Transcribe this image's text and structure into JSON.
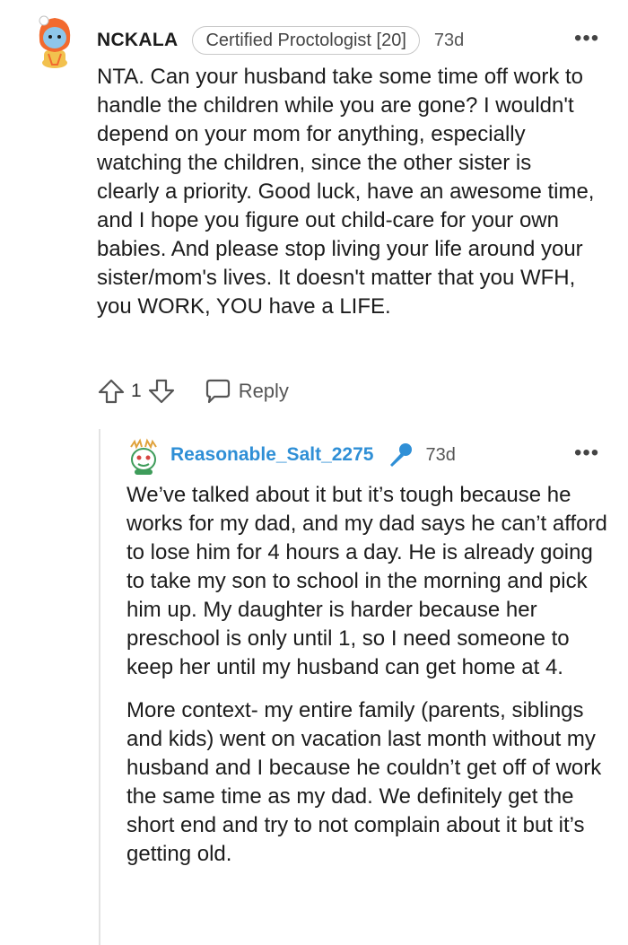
{
  "comment": {
    "author": "NCKALA",
    "flair": "Certified Proctologist [20]",
    "age": "73d",
    "body": "NTA. Can your husband take some time off work to handle the children while you are gone? I wouldn't depend on your mom for anything, especially watching the children, since the other sister is clearly a priority. Good luck, have an awesome time, and I hope you figure out child-care for your own babies. And please stop living your life around your sister/mom's lives. It doesn't matter that you WFH, you WORK, YOU have a LIFE.",
    "vote_count": "1",
    "reply_label": "Reply",
    "more_label": "•••"
  },
  "reply": {
    "author": "Reasonable_Salt_2275",
    "age": "73d",
    "paragraphs": [
      "We’ve talked about it but it’s tough because he works for my dad, and my dad says he can’t afford to lose him for 4 hours a day. He is already going to take my son to school in the morning and pick him up. My daughter is harder because her preschool is only until 1, so I need someone to keep her until my husband can get home at 4.",
      "More context- my entire family (parents, siblings and kids) went on vacation last month without my husband and I because he couldn’t get off of work the same time as my dad. We definitely get the short end and try to not complain about it but it’s getting old."
    ],
    "more_label": "•••"
  },
  "colors": {
    "reply_author": "#2f8fd6",
    "thread_line": "#e3e3e3",
    "avatar_orange": "#f26a2e",
    "avatar_face": "#8ec6ea",
    "mic_blue": "#2f8fd6"
  },
  "icons": {
    "upvote": "upvote-arrow-icon",
    "downvote": "downvote-arrow-icon",
    "reply": "speech-bubble-icon",
    "more": "more-options-icon",
    "mic": "microphone-icon"
  }
}
